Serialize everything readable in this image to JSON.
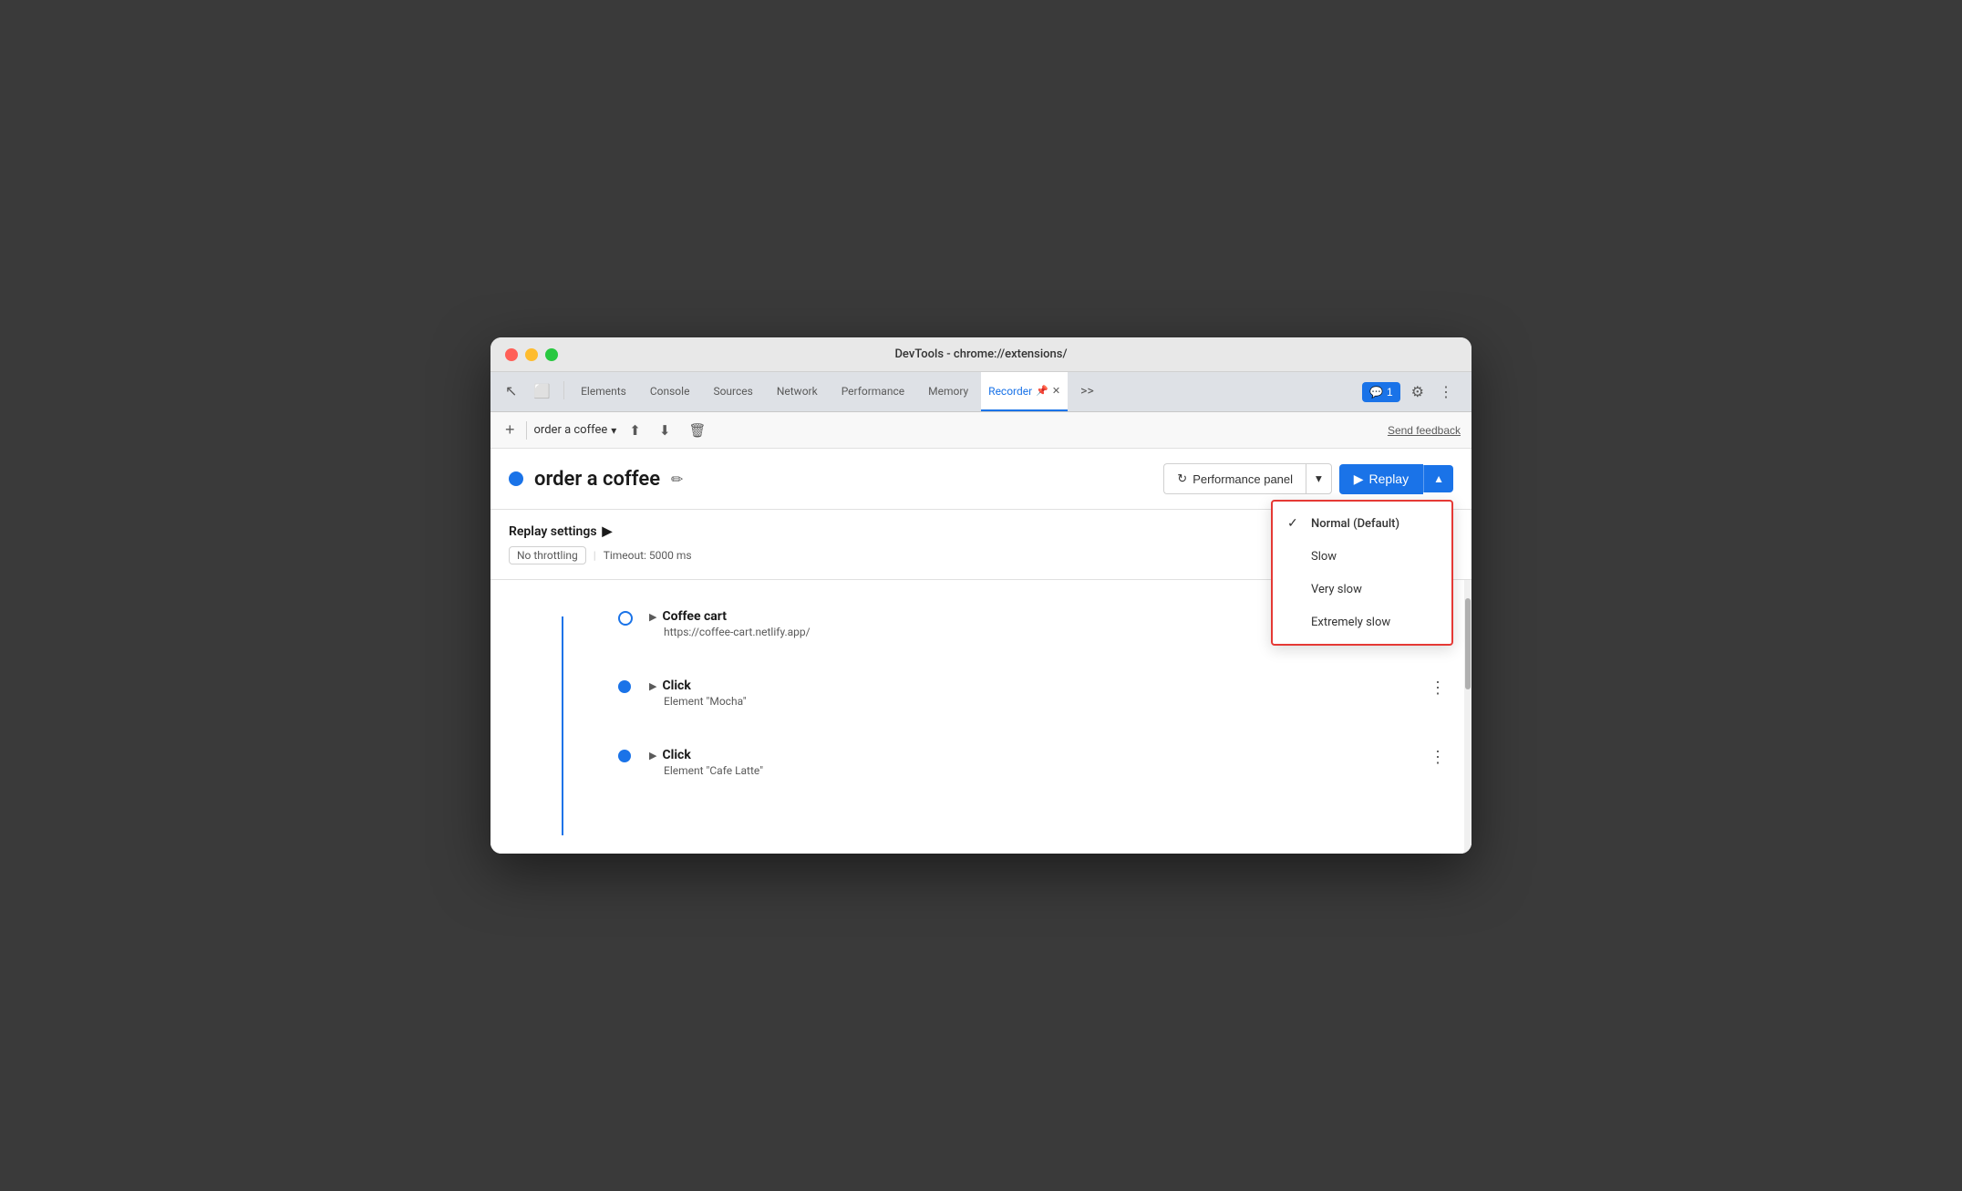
{
  "window": {
    "title": "DevTools - chrome://extensions/"
  },
  "titlebar": {
    "title": "DevTools - chrome://extensions/"
  },
  "tabs": [
    {
      "label": "Elements",
      "active": false
    },
    {
      "label": "Console",
      "active": false
    },
    {
      "label": "Sources",
      "active": false
    },
    {
      "label": "Network",
      "active": false
    },
    {
      "label": "Performance",
      "active": false
    },
    {
      "label": "Memory",
      "active": false
    },
    {
      "label": "Recorder",
      "active": true
    }
  ],
  "devtools_right": {
    "chat_label": "1",
    "more_label": ">>"
  },
  "toolbar": {
    "add_label": "+",
    "recording_name": "order a coffee",
    "send_feedback": "Send feedback"
  },
  "recording_header": {
    "name": "order a coffee",
    "perf_panel_label": "Performance panel",
    "replay_label": "Replay"
  },
  "replay_settings": {
    "title": "Replay settings",
    "arrow": "▶",
    "no_throttling": "No throttling",
    "timeout": "Timeout: 5000 ms"
  },
  "dropdown": {
    "items": [
      {
        "label": "Normal (Default)",
        "selected": true
      },
      {
        "label": "Slow",
        "selected": false
      },
      {
        "label": "Very slow",
        "selected": false
      },
      {
        "label": "Extremely slow",
        "selected": false
      }
    ]
  },
  "steps": [
    {
      "type": "navigation",
      "title": "Coffee cart",
      "url": "https://coffee-cart.netlify.app/",
      "dot_filled": false
    },
    {
      "type": "click",
      "title": "Click",
      "subtitle": "Element \"Mocha\"",
      "dot_filled": true
    },
    {
      "type": "click",
      "title": "Click",
      "subtitle": "Element \"Cafe Latte\"",
      "dot_filled": true
    }
  ]
}
